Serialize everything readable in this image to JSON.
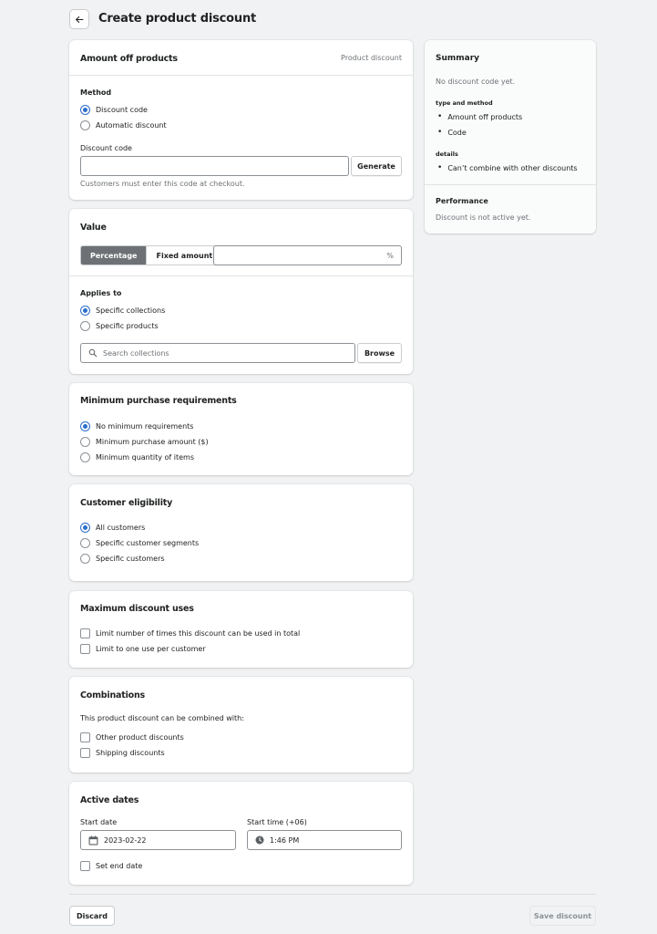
{
  "header": {
    "title": "Create product discount",
    "back_icon": "arrow-left-icon"
  },
  "amount_card": {
    "title": "Amount off products",
    "type_label": "Product discount",
    "method_label": "Method",
    "method_options": [
      "Discount code",
      "Automatic discount"
    ],
    "selected_method": "Discount code",
    "code_label": "Discount code",
    "code_value": "",
    "generate_label": "Generate",
    "help_text": "Customers must enter this code at checkout."
  },
  "value_card": {
    "title": "Value",
    "types": [
      "Percentage",
      "Fixed amount"
    ],
    "selected_type": "Percentage",
    "value": "",
    "suffix": "%",
    "applies_label": "Applies to",
    "applies_options": [
      "Specific collections",
      "Specific products"
    ],
    "selected_applies": "Specific collections",
    "search_placeholder": "Search collections",
    "browse_label": "Browse"
  },
  "min_card": {
    "title": "Minimum purchase requirements",
    "options": [
      "No minimum requirements",
      "Minimum purchase amount ($)",
      "Minimum quantity of items"
    ],
    "selected": "No minimum requirements"
  },
  "eligibility_card": {
    "title": "Customer eligibility",
    "options": [
      "All customers",
      "Specific customer segments",
      "Specific customers"
    ],
    "selected": "All customers"
  },
  "max_uses_card": {
    "title": "Maximum discount uses",
    "options": [
      "Limit number of times this discount can be used in total",
      "Limit to one use per customer"
    ]
  },
  "combinations_card": {
    "title": "Combinations",
    "description": "This product discount can be combined with:",
    "options": [
      "Other product discounts",
      "Shipping discounts"
    ]
  },
  "dates_card": {
    "title": "Active dates",
    "start_date_label": "Start date",
    "start_date": "2023-02-22",
    "start_time_label": "Start time (+06)",
    "start_time": "1:46 PM",
    "end_date_label": "Set end date"
  },
  "summary": {
    "title": "Summary",
    "no_code": "No discount code yet.",
    "type_method_label": "type and method",
    "type_method_items": [
      "Amount off products",
      "Code"
    ],
    "details_label": "details",
    "details_items": [
      "Can’t combine with other discounts"
    ],
    "performance_title": "Performance",
    "performance_text": "Discount is not active yet."
  },
  "footer": {
    "discard_label": "Discard",
    "save_label": "Save discount"
  },
  "colors": {
    "accent": "#2c6ecb",
    "selected_segment": "#6d7175",
    "background": "#f1f2f3"
  }
}
